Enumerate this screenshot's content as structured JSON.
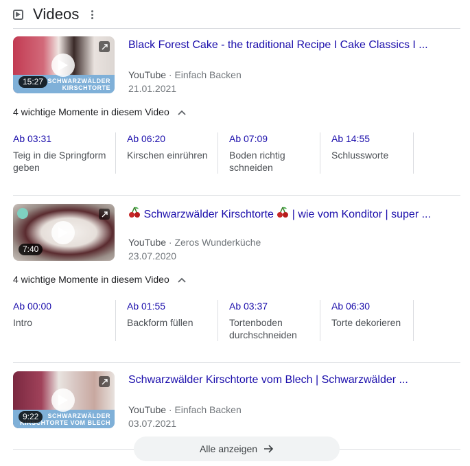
{
  "header": {
    "title": "Videos"
  },
  "videos": [
    {
      "title": "Black Forest Cake - the traditional Recipe I Cake Classics I ...",
      "source": "YouTube",
      "channel": "Einfach Backen",
      "date": "21.01.2021",
      "duration": "15:27",
      "thumb_text": "Schwarzwälder Kirschtorte",
      "moments_label": "4 wichtige Momente in diesem Video",
      "moments": [
        {
          "time": "Ab 03:31",
          "label": "Teig in die Springform geben"
        },
        {
          "time": "Ab 06:20",
          "label": "Kirschen einrühren"
        },
        {
          "time": "Ab 07:09",
          "label": "Boden richtig schneiden"
        },
        {
          "time": "Ab 14:55",
          "label": "Schlussworte"
        }
      ]
    },
    {
      "title_main": "Schwarzwälder Kirschtorte",
      "title_rest": "| wie vom Konditor | super ...",
      "source": "YouTube",
      "channel": "Zeros Wunderküche",
      "date": "23.07.2020",
      "duration": "7:40",
      "moments_label": "4 wichtige Momente in diesem Video",
      "moments": [
        {
          "time": "Ab 00:00",
          "label": "Intro"
        },
        {
          "time": "Ab 01:55",
          "label": "Backform füllen"
        },
        {
          "time": "Ab 03:37",
          "label": "Tortenboden durchschneiden"
        },
        {
          "time": "Ab 06:30",
          "label": "Torte dekorieren"
        }
      ]
    },
    {
      "title": "Schwarzwälder Kirschtorte vom Blech | Schwarzwälder ...",
      "source": "YouTube",
      "channel": "Einfach Backen",
      "date": "03.07.2021",
      "duration": "9:22",
      "thumb_text": "Schwarzwälder Kirschtorte vom Blech"
    }
  ],
  "footer": {
    "show_all_label": "Alle anzeigen"
  },
  "colors": {
    "link": "#1a0dab",
    "meta": "#70757a",
    "divider": "#dadce0",
    "button_bg": "#f1f3f4"
  },
  "icons": [
    "video-play-icon",
    "more-vert-icon",
    "play-icon",
    "expand-icon",
    "chevron-up-icon",
    "cherry-icon",
    "arrow-right-icon"
  ]
}
